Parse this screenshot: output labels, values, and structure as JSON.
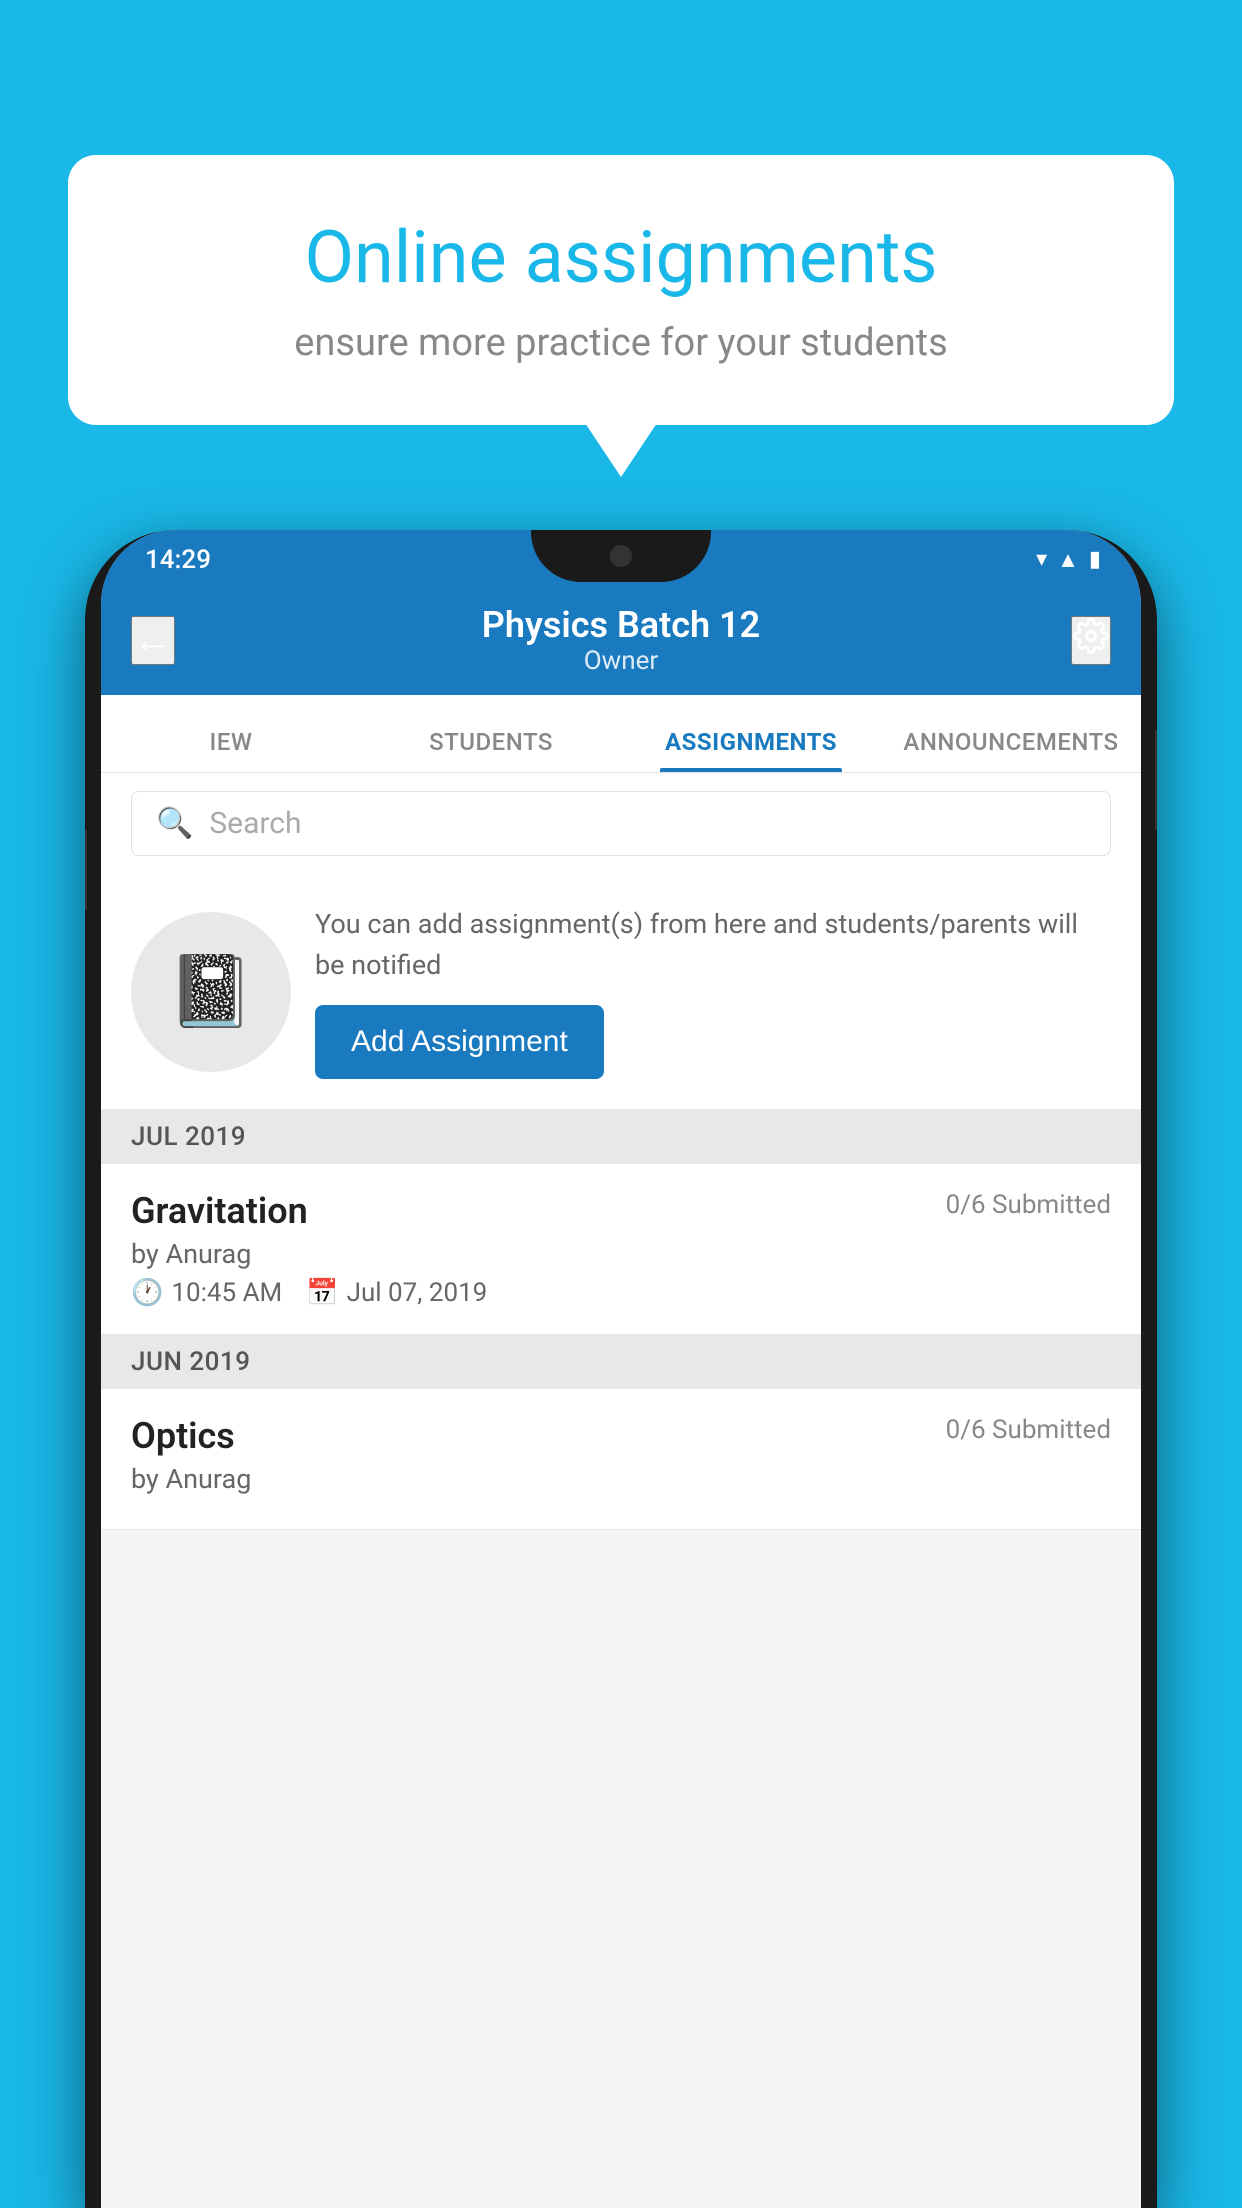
{
  "background_color": "#1ab8e8",
  "speech_bubble": {
    "title": "Online assignments",
    "subtitle": "ensure more practice for your students"
  },
  "status_bar": {
    "time": "14:29",
    "icons": [
      "wifi",
      "signal",
      "battery"
    ]
  },
  "app_bar": {
    "title": "Physics Batch 12",
    "subtitle": "Owner",
    "back_label": "←",
    "settings_label": "⚙"
  },
  "tabs": [
    {
      "label": "IEW",
      "active": false
    },
    {
      "label": "STUDENTS",
      "active": false
    },
    {
      "label": "ASSIGNMENTS",
      "active": true
    },
    {
      "label": "ANNOUNCEMENTS",
      "active": false
    }
  ],
  "search": {
    "placeholder": "Search"
  },
  "promo": {
    "description": "You can add assignment(s) from here and students/parents will be notified",
    "button_label": "Add Assignment"
  },
  "sections": [
    {
      "month": "JUL 2019",
      "assignments": [
        {
          "title": "Gravitation",
          "submitted": "0/6 Submitted",
          "author": "by Anurag",
          "time": "10:45 AM",
          "date": "Jul 07, 2019"
        }
      ]
    },
    {
      "month": "JUN 2019",
      "assignments": [
        {
          "title": "Optics",
          "submitted": "0/6 Submitted",
          "author": "by Anurag",
          "time": "",
          "date": ""
        }
      ]
    }
  ]
}
